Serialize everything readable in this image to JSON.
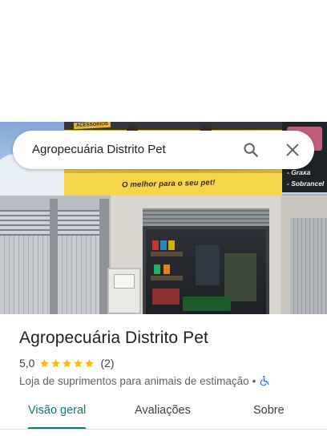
{
  "search": {
    "query": "Agropecuária Distrito Pet",
    "search_icon": "search-icon",
    "close_icon": "close-icon"
  },
  "photo": {
    "banner_top_label": "ACESSÓRIOS",
    "slogan": "O melhor para o seu pet!",
    "side_sign_lines": [
      "- Graxa",
      "- Sobrancel"
    ]
  },
  "place": {
    "name": "Agropecuária Distrito Pet",
    "rating": "5,0",
    "stars": 5,
    "review_count": "(2)",
    "category": "Loja de suprimentos para animais de estimação",
    "separator": "•",
    "accessibility_icon": "wheelchair-icon"
  },
  "tabs": [
    {
      "label": "Visão geral",
      "active": true
    },
    {
      "label": "Avaliações",
      "active": false
    },
    {
      "label": "Sobre",
      "active": false
    }
  ],
  "colors": {
    "accent": "#0b7a74",
    "star": "#fbbc04",
    "accessibility": "#1a73e8"
  }
}
